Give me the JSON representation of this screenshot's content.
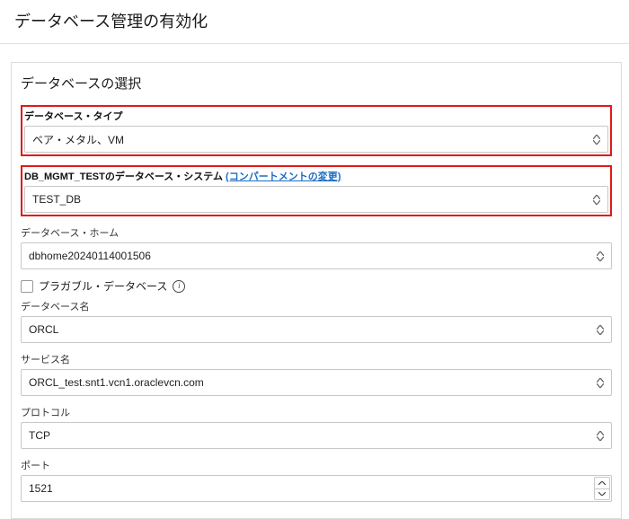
{
  "page": {
    "title": "データベース管理の有効化"
  },
  "panel": {
    "title": "データベースの選択"
  },
  "fields": {
    "db_type": {
      "label": "データベース・タイプ",
      "value": "ベア・メタル、VM"
    },
    "db_system": {
      "label_prefix": "DB_MGMT_TEST",
      "label_suffix": "のデータベース・システム ",
      "change_link": "(コンパートメントの変更)",
      "value": "TEST_DB"
    },
    "db_home": {
      "label": "データベース・ホーム",
      "value": "dbhome20240114001506"
    },
    "pluggable": {
      "label": "プラガブル・データベース"
    },
    "db_name": {
      "label": "データベース名",
      "value": "ORCL"
    },
    "service_name": {
      "label": "サービス名",
      "value": "ORCL_test.snt1.vcn1.oraclevcn.com"
    },
    "protocol": {
      "label": "プロトコル",
      "value": "TCP"
    },
    "port": {
      "label": "ポート",
      "value": "1521"
    }
  }
}
